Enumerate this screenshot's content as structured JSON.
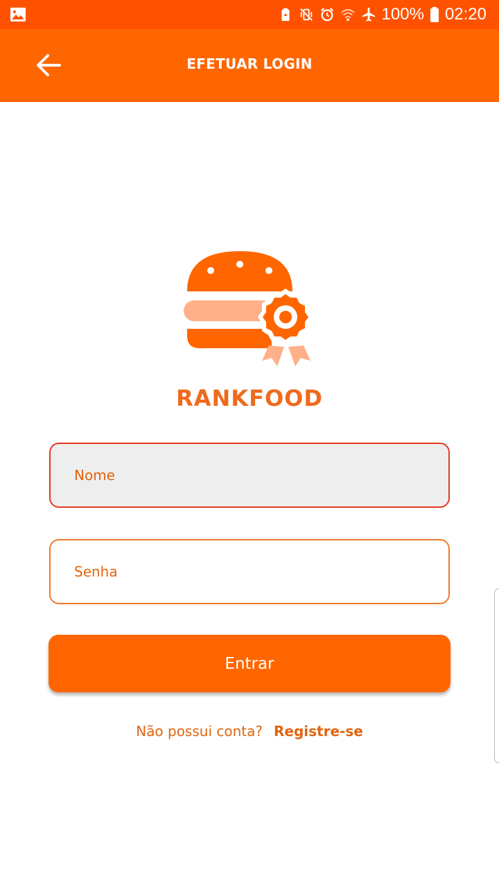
{
  "status_bar": {
    "battery_percent": "100%",
    "time": "02:20",
    "icons": [
      "gallery-icon",
      "battery-saver-icon",
      "vibrate-icon",
      "alarm-icon",
      "wifi-icon",
      "airplane-icon",
      "battery-icon"
    ]
  },
  "app_bar": {
    "back_icon": "arrow-back-icon",
    "title": "EFETUAR LOGIN"
  },
  "logo": {
    "icon": "burger-award-icon",
    "brand_name": "RANKFOOD"
  },
  "form": {
    "name_placeholder": "Nome",
    "password_placeholder": "Senha",
    "submit_label": "Entrar"
  },
  "register": {
    "prompt": "Não possui conta?",
    "link_label": "Registre-se"
  },
  "colors": {
    "status_bar": "#ff5200",
    "app_bar": "#ff6600",
    "accent": "#ef6a1c",
    "logo_light": "#ffb088",
    "field_focus_border": "#e03a22"
  }
}
